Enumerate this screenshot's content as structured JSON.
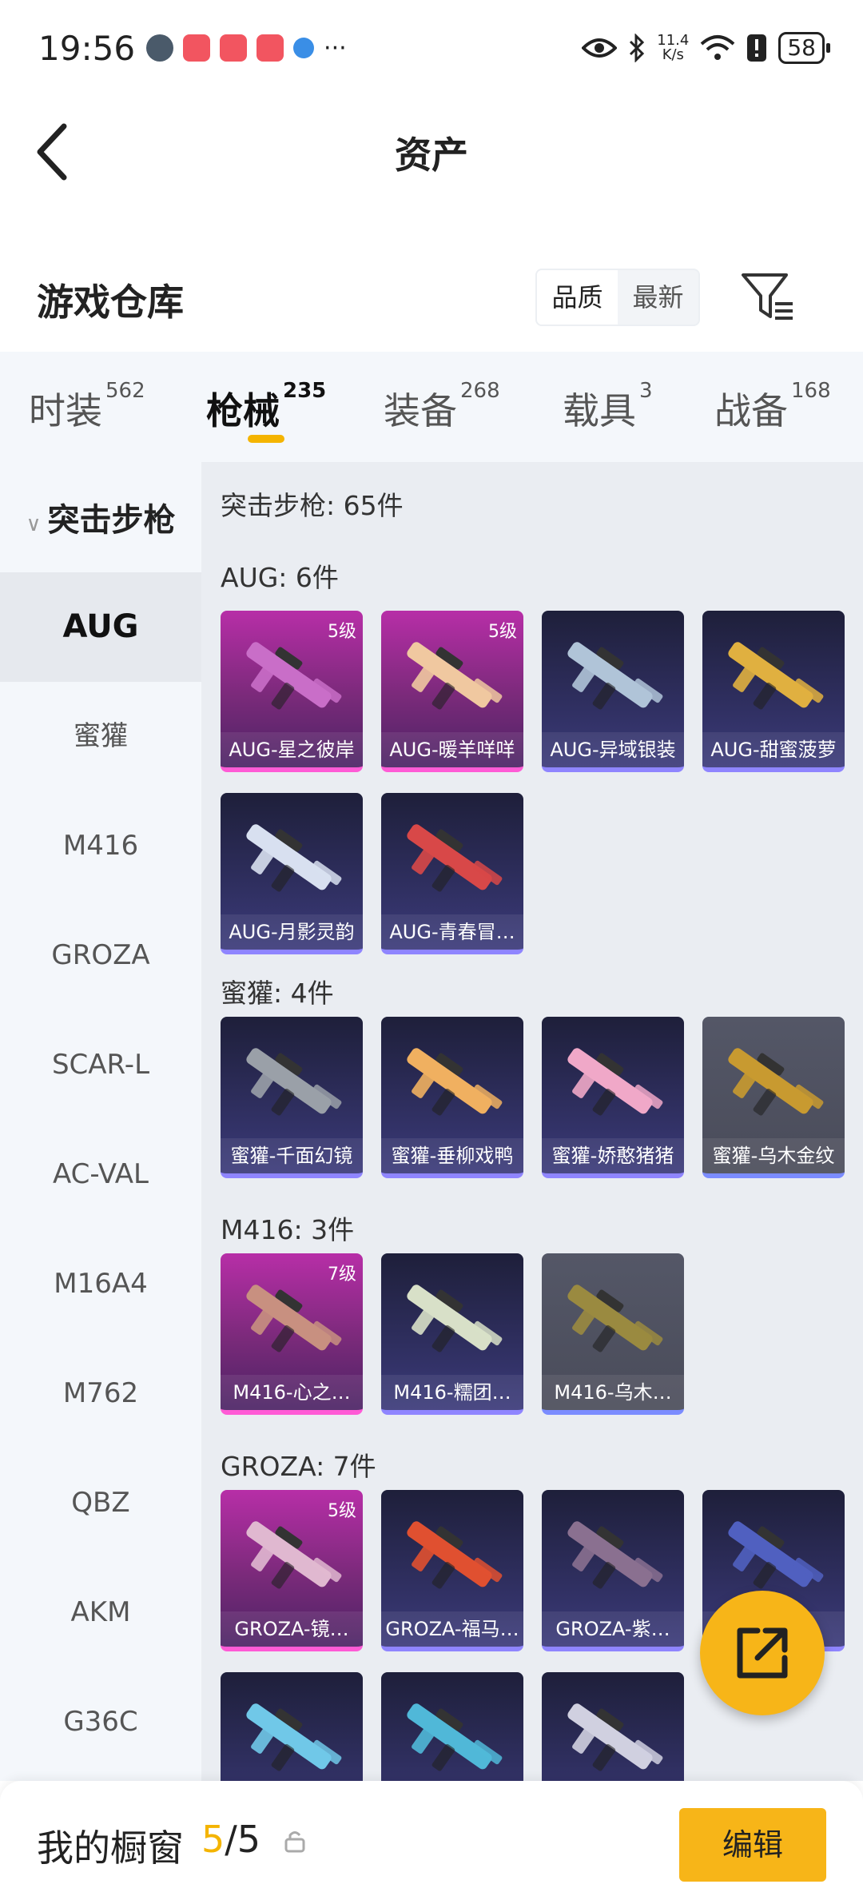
{
  "status": {
    "time": "19:56",
    "net_speed_value": "11.4",
    "net_speed_unit": "K/s",
    "battery": "58",
    "more": "···"
  },
  "header": {
    "title": "资产"
  },
  "warehouse": {
    "title": "游戏仓库",
    "sort_options": [
      "品质",
      "最新"
    ],
    "sort_selected": "品质"
  },
  "tabs": [
    {
      "label": "时装",
      "count": "562"
    },
    {
      "label": "枪械",
      "count": "235"
    },
    {
      "label": "装备",
      "count": "268"
    },
    {
      "label": "载具",
      "count": "3"
    },
    {
      "label": "战备",
      "count": "168"
    }
  ],
  "active_tab": "枪械",
  "sidebar": {
    "category": "突击步枪",
    "items": [
      "AUG",
      "蜜獾",
      "M416",
      "GROZA",
      "SCAR-L",
      "AC-VAL",
      "M16A4",
      "M762",
      "QBZ",
      "AKM",
      "G36C"
    ],
    "selected": "AUG"
  },
  "main": {
    "category_summary": "突击步枪: 65件",
    "groups": [
      {
        "title": "AUG: 6件",
        "items": [
          {
            "name": "AUG-星之彼岸",
            "level": "5级",
            "rarity": "pink",
            "color": "#c96ec8"
          },
          {
            "name": "AUG-暖羊咩咩",
            "level": "5级",
            "rarity": "pink",
            "color": "#f0c8a0"
          },
          {
            "name": "AUG-异域银装",
            "level": "",
            "rarity": "purple",
            "color": "#b0c4d8"
          },
          {
            "name": "AUG-甜蜜菠萝",
            "level": "",
            "rarity": "purple",
            "color": "#e0b040"
          },
          {
            "name": "AUG-月影灵韵",
            "level": "",
            "rarity": "purple",
            "color": "#d8e0f0"
          },
          {
            "name": "AUG-青春冒…",
            "level": "",
            "rarity": "purple",
            "color": "#d84848"
          }
        ]
      },
      {
        "title": "蜜獾: 4件",
        "items": [
          {
            "name": "蜜獾-千面幻镜",
            "level": "",
            "rarity": "purple",
            "color": "#9aa0a8"
          },
          {
            "name": "蜜獾-垂柳戏鸭",
            "level": "",
            "rarity": "purple",
            "color": "#f0b060"
          },
          {
            "name": "蜜獾-娇憨猪猪",
            "level": "",
            "rarity": "purple",
            "color": "#f0a8c8"
          },
          {
            "name": "蜜獾-乌木金纹",
            "level": "",
            "rarity": "gray",
            "color": "#c89a30"
          }
        ]
      },
      {
        "title": "M416: 3件",
        "items": [
          {
            "name": "M416-心之…",
            "level": "7级",
            "rarity": "pink",
            "color": "#c89080"
          },
          {
            "name": "M416-糯团…",
            "level": "",
            "rarity": "purple",
            "color": "#d8e0c8"
          },
          {
            "name": "M416-乌木…",
            "level": "",
            "rarity": "gray",
            "color": "#9a8a40"
          }
        ]
      },
      {
        "title": "GROZA: 7件",
        "items": [
          {
            "name": "GROZA-镜…",
            "level": "5级",
            "rarity": "pink",
            "color": "#e0b8d0"
          },
          {
            "name": "GROZA-福马…",
            "level": "",
            "rarity": "purple",
            "color": "#e05030"
          },
          {
            "name": "GROZA-紫…",
            "level": "",
            "rarity": "purple",
            "color": "#8a7090"
          },
          {
            "name": "",
            "level": "",
            "rarity": "purple",
            "color": "#5060c0"
          },
          {
            "name": "",
            "level": "",
            "rarity": "purple",
            "color": "#70c8e8"
          },
          {
            "name": "",
            "level": "",
            "rarity": "purple",
            "color": "#50b8d8"
          },
          {
            "name": "",
            "level": "",
            "rarity": "purple",
            "color": "#d0d0e0"
          }
        ]
      }
    ]
  },
  "bottom": {
    "title": "我的橱窗",
    "count_current": "5",
    "count_sep_total": "/5",
    "edit_label": "编辑"
  },
  "colors": {
    "accent": "#f7b518",
    "pink_card": "#b72ea7",
    "purple_card": "#3b3a7a",
    "gray_card": "#545767"
  }
}
